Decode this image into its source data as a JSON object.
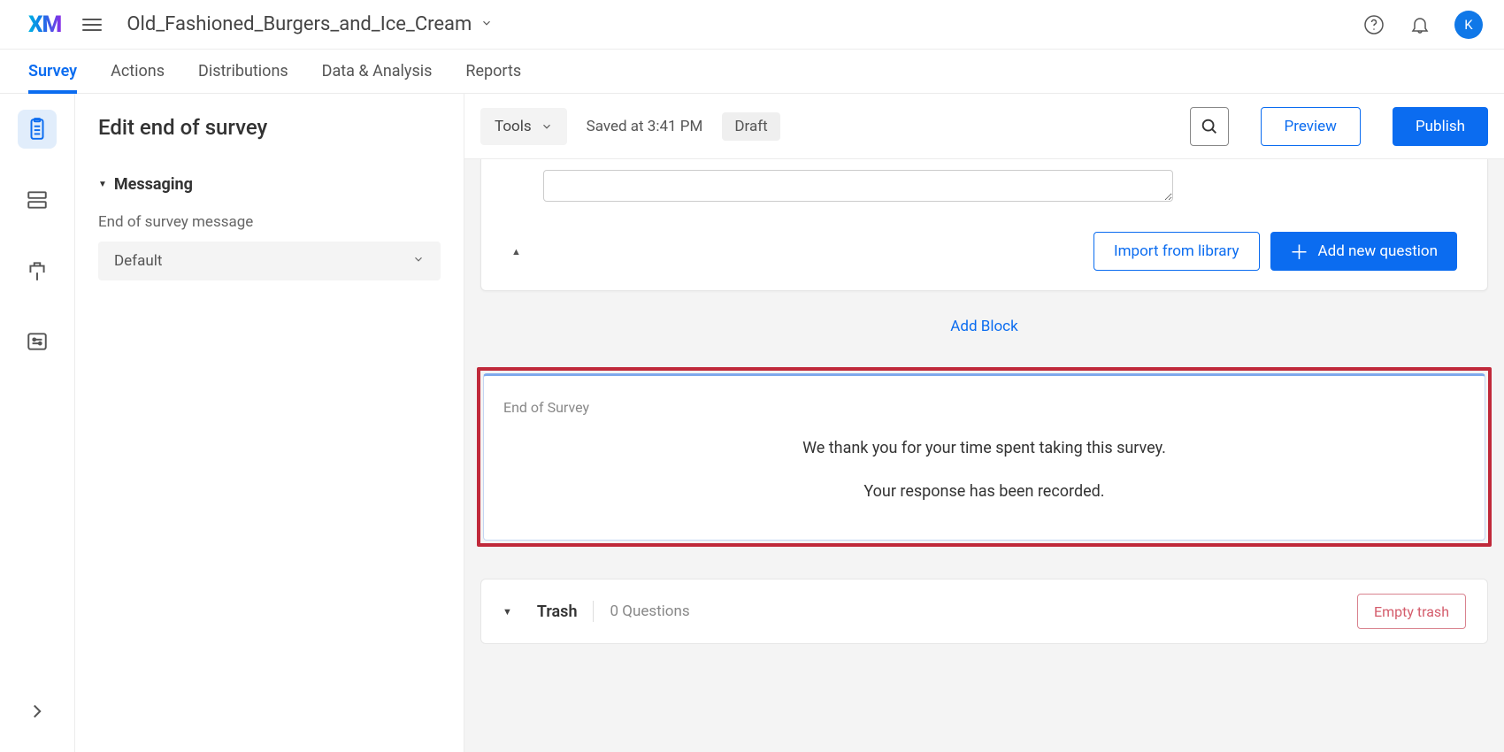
{
  "topbar": {
    "logo": "XM",
    "project_name": "Old_Fashioned_Burgers_and_Ice_Cream",
    "avatar_letter": "K"
  },
  "tabs": {
    "items": [
      "Survey",
      "Actions",
      "Distributions",
      "Data & Analysis",
      "Reports"
    ],
    "active_index": 0
  },
  "rail": {
    "items": [
      "builder-icon",
      "flow-icon",
      "look-icon",
      "options-icon"
    ],
    "expand": "chevron-right-icon"
  },
  "sidepanel": {
    "title": "Edit end of survey",
    "section": "Messaging",
    "field_label": "End of survey message",
    "select_value": "Default"
  },
  "toolbar": {
    "tools": "Tools",
    "saved_text": "Saved at 3:41 PM",
    "draft": "Draft",
    "preview": "Preview",
    "publish": "Publish"
  },
  "block": {
    "import_label": "Import from library",
    "add_question_label": "Add new question"
  },
  "add_block_label": "Add Block",
  "eos": {
    "label": "End of Survey",
    "line1": "We thank you for your time spent taking this survey.",
    "line2": "Your response has been recorded."
  },
  "trash": {
    "label": "Trash",
    "count_text": "0 Questions",
    "empty_label": "Empty trash"
  }
}
